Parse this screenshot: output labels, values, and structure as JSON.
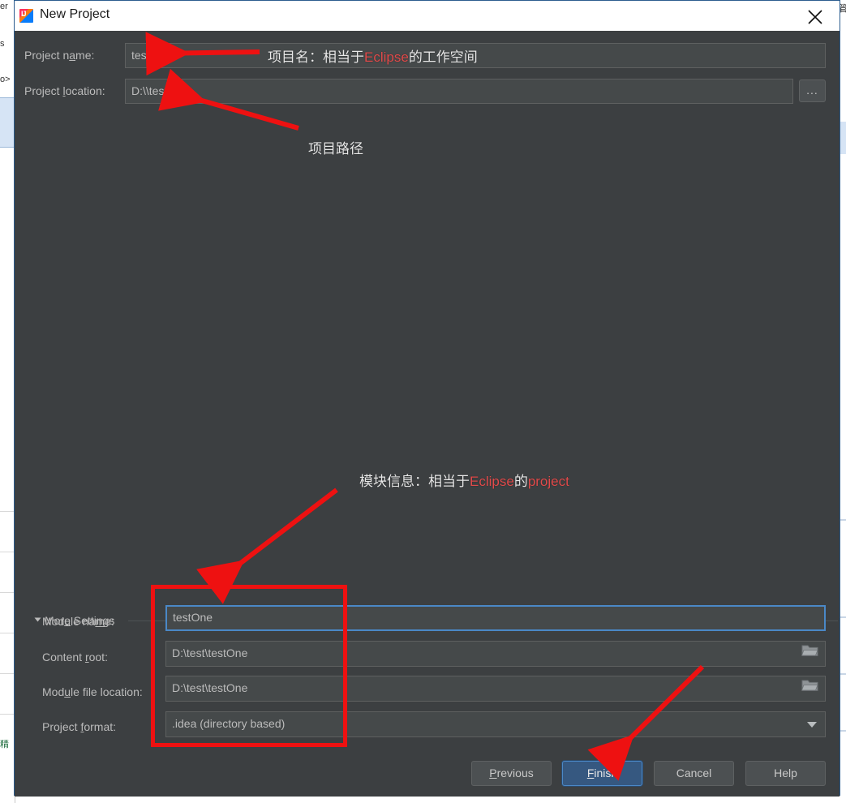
{
  "window": {
    "title": "New Project",
    "icon": "intellij-idea-icon",
    "close_icon": "close-icon"
  },
  "form": {
    "project_name": {
      "label": "Project name:",
      "label_pre": "Project n",
      "label_accel": "a",
      "label_post": "me:",
      "value": "test"
    },
    "project_location": {
      "label": "Project location:",
      "label_pre": "Project ",
      "label_accel": "l",
      "label_post": "ocation:",
      "value": "D:\\\\test",
      "browse_button": "..."
    }
  },
  "more_settings": {
    "label": "More Settings",
    "label_pre": "Mor",
    "label_accel": "e",
    "label_post": " Settings",
    "expanded": true,
    "fields": [
      {
        "name": "module-name",
        "label": "Module name:",
        "label_pre": "Module na",
        "label_accel": "m",
        "label_post": "e:",
        "value": "testOne",
        "focused": true,
        "trailing_icon": null
      },
      {
        "name": "content-root",
        "label": "Content root:",
        "label_pre": "Content ",
        "label_accel": "r",
        "label_post": "oot:",
        "value": "D:\\test\\testOne",
        "focused": false,
        "trailing_icon": "folder-icon"
      },
      {
        "name": "module-file-location",
        "label": "Module file location:",
        "label_pre": "Mod",
        "label_accel": "u",
        "label_post": "le file location:",
        "value": "D:\\test\\testOne",
        "focused": false,
        "trailing_icon": "folder-icon"
      },
      {
        "name": "project-format",
        "label": "Project format:",
        "label_pre": "Project ",
        "label_accel": "f",
        "label_post": "ormat:",
        "value": ".idea (directory based)",
        "focused": false,
        "trailing_icon": "chevron-down-icon"
      }
    ]
  },
  "footer": {
    "buttons": [
      {
        "name": "previous",
        "label": "Previous",
        "pre": "",
        "accel": "P",
        "post": "revious",
        "primary": false
      },
      {
        "name": "finish",
        "label": "Finish",
        "pre": "",
        "accel": "F",
        "post": "inish",
        "primary": true
      },
      {
        "name": "cancel",
        "label": "Cancel",
        "pre": "Cancel",
        "accel": "",
        "post": "",
        "primary": false
      },
      {
        "name": "help",
        "label": "Help",
        "pre": "Help",
        "accel": "",
        "post": "",
        "primary": false
      }
    ]
  },
  "annotations": {
    "project_name_note": {
      "prefix": "项目名：相当于",
      "highlight": "Eclipse",
      "suffix": "的工作空间"
    },
    "project_path_note": {
      "text": "项目路径"
    },
    "module_note": {
      "prefix": "模块信息：相当于",
      "highlight": "Eclipse",
      "middle": "的",
      "highlight2": "project"
    },
    "marker_color": "#ee1111"
  },
  "background": {
    "left_fragments": [
      "er",
      "s",
      "o>"
    ],
    "right_fragment": "管"
  }
}
